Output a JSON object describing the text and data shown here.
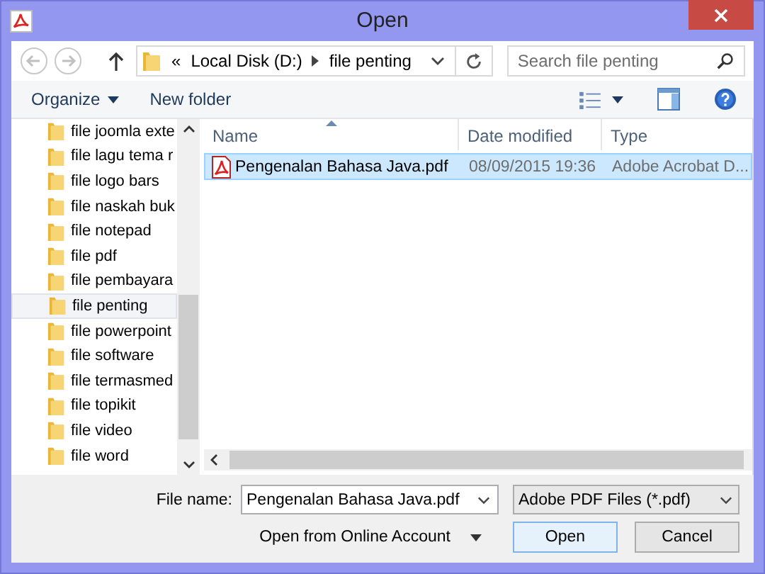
{
  "window": {
    "title": "Open"
  },
  "navigation": {
    "overflow_mark": "«",
    "path": [
      {
        "label": "Local Disk (D:)"
      },
      {
        "label": "file penting"
      }
    ],
    "search": {
      "placeholder": "Search file penting"
    }
  },
  "toolbar": {
    "organize": "Organize",
    "new_folder": "New folder"
  },
  "sidebar": {
    "items": [
      {
        "label": "file joomla exte",
        "selected": false
      },
      {
        "label": "file lagu tema r",
        "selected": false
      },
      {
        "label": "file logo bars",
        "selected": false
      },
      {
        "label": "file naskah buk",
        "selected": false
      },
      {
        "label": "file notepad",
        "selected": false
      },
      {
        "label": "file pdf",
        "selected": false
      },
      {
        "label": "file pembayara",
        "selected": false
      },
      {
        "label": "file penting",
        "selected": true
      },
      {
        "label": "file powerpoint",
        "selected": false
      },
      {
        "label": "file software",
        "selected": false
      },
      {
        "label": "file termasmed",
        "selected": false
      },
      {
        "label": "file topikit",
        "selected": false
      },
      {
        "label": "file video",
        "selected": false
      },
      {
        "label": "file word",
        "selected": false
      }
    ]
  },
  "file_list": {
    "columns": [
      "Name",
      "Date modified",
      "Type"
    ],
    "rows": [
      {
        "name": "Pengenalan Bahasa Java.pdf",
        "date": "08/09/2015 19:36",
        "type": "Adobe Acrobat D...",
        "selected": true
      }
    ]
  },
  "file_name": {
    "label": "File name:",
    "value": "Pengenalan Bahasa Java.pdf"
  },
  "file_type": {
    "value": "Adobe PDF Files (*.pdf)"
  },
  "buttons": {
    "online": "Open from Online Account",
    "open": "Open",
    "cancel": "Cancel"
  }
}
